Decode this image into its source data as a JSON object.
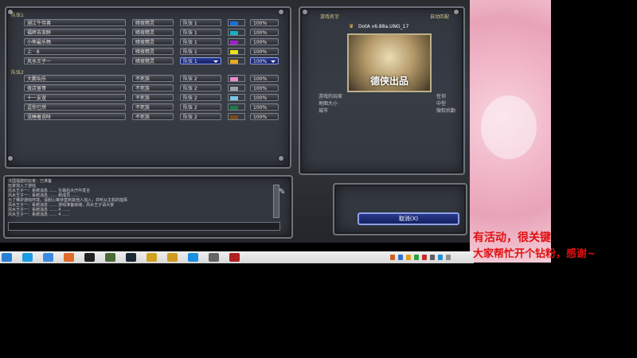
{
  "top_section_label": "队伍1",
  "bottom_section_label": "队伍2",
  "team1_rows": [
    {
      "name": "湖江牛侍酋",
      "mode": "暗夜精灵",
      "team": "队伍 1",
      "color": "#1d6fd8",
      "handicap": "100%",
      "highlight": false
    },
    {
      "name": "福畔去亚醉",
      "mode": "暗夜精灵",
      "team": "队伍 1",
      "color": "#16b2c2",
      "handicap": "100%",
      "highlight": false
    },
    {
      "name": "小熊最乐畅",
      "mode": "暗夜精灵",
      "team": "队伍 1",
      "color": "#a020c8",
      "handicap": "100%",
      "highlight": false
    },
    {
      "name": "上 · 8",
      "mode": "暗夜精灵",
      "team": "队伍 1",
      "color": "#e8e41c",
      "handicap": "100%",
      "highlight": false
    },
    {
      "name": "风水王子一",
      "mode": "暗夜精灵",
      "team": "队伍 1",
      "color": "#e8a81c",
      "handicap": "100%",
      "highlight": true
    }
  ],
  "team2_rows": [
    {
      "name": "大鹏仙乐",
      "mode": "不死族",
      "team": "队伍 2",
      "color": "#e88cc8",
      "handicap": "100%",
      "highlight": false
    },
    {
      "name": "夜店留哥",
      "mode": "不死族",
      "team": "队伍 2",
      "color": "#9aa2a6",
      "handicap": "100%",
      "highlight": false
    },
    {
      "name": "十一友谊",
      "mode": "不死族",
      "team": "队伍 2",
      "color": "#7ec2e6",
      "handicap": "100%",
      "highlight": false
    },
    {
      "name": "逗你已然",
      "mode": "不死族",
      "team": "队伍 2",
      "color": "#1c7a4a",
      "handicap": "100%",
      "highlight": false
    },
    {
      "name": "没睡着说呀",
      "mode": "不死族",
      "team": "队伍 2",
      "color": "#7a4a1c",
      "handicap": "100%",
      "highlight": false
    }
  ],
  "map_panel": {
    "title": "游戏名字",
    "auto_label": "自动匹配",
    "map_name": "DotA v6.88a.UNG_17",
    "thumbnail_text": "德侠出品",
    "info": [
      {
        "label": "游戏的玩家",
        "value": "任何"
      },
      {
        "label": "地图大小",
        "value": "中型"
      },
      {
        "label": "城市",
        "value": "微软后勤"
      }
    ]
  },
  "chat_lines": [
    "法国福建的玩家：已准备",
    "玩家加入了游戏",
    "风水王子一：系统消息 …… 在最后大厅中发言",
    "风水王子一：系统消息 …… 新成员 ……",
    "为了维护游戏环境，请耐心等待直到其他人加入，并听从主机的指挥",
    "风水王子一：系统消息 …… 游戏准备就绪，风水王子请大家",
    "风水王子一：系统消息 …… 4 ……",
    "风水王子一：系统消息 …… 4 ……"
  ],
  "cancel_button": "取消(X)",
  "overlay": {
    "line1": "有活动，很关键",
    "line2": "大家帮忙开个钻粉，感谢~"
  },
  "taskbar_icons": [
    "start",
    "ie",
    "qq-mail",
    "chat",
    "player",
    "game",
    "steam",
    "photos",
    "wps",
    "security",
    "folder",
    "game2"
  ]
}
